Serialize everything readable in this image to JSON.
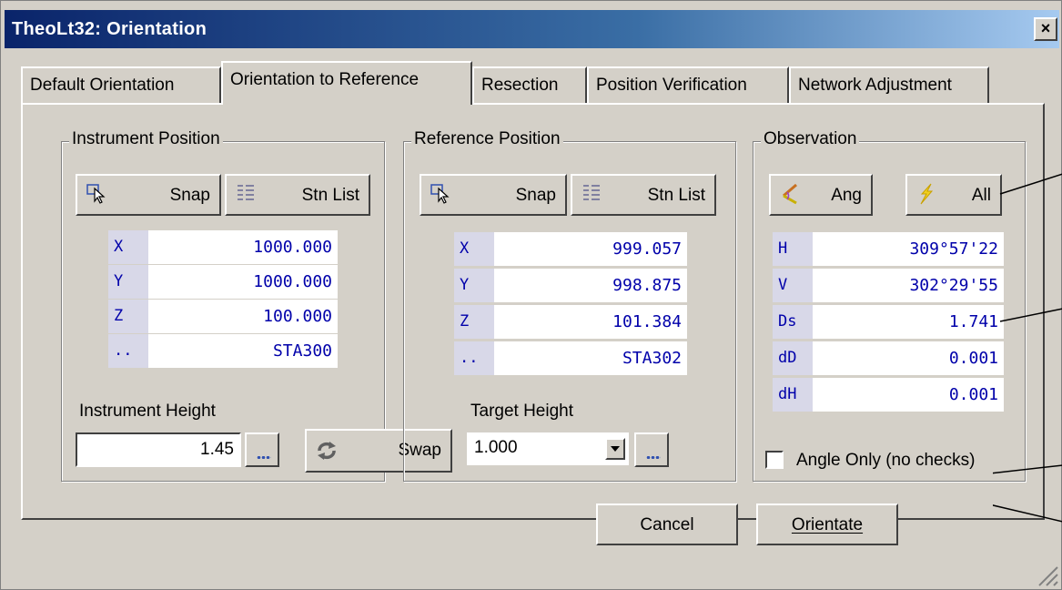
{
  "window": {
    "title": "TheoLt32: Orientation",
    "close_label": "×"
  },
  "tabs": [
    "Default Orientation",
    "Orientation to Reference",
    "Resection",
    "Position Verification",
    "Network Adjustment"
  ],
  "instrument": {
    "title": "Instrument Position",
    "snap": "Snap",
    "stnlist": "Stn List",
    "rows": [
      {
        "label": "X",
        "value": "1000.000"
      },
      {
        "label": "Y",
        "value": "1000.000"
      },
      {
        "label": "Z",
        "value": "100.000"
      },
      {
        "label": "..",
        "value": "STA300"
      }
    ],
    "height_label": "Instrument Height",
    "height_value": "1.45"
  },
  "reference": {
    "title": "Reference Position",
    "snap": "Snap",
    "stnlist": "Stn List",
    "rows": [
      {
        "label": "X",
        "value": "999.057"
      },
      {
        "label": "Y",
        "value": "998.875"
      },
      {
        "label": "Z",
        "value": "101.384"
      },
      {
        "label": "..",
        "value": "STA302"
      }
    ],
    "height_label": "Target Height",
    "height_value": "1.000"
  },
  "swap_label": "Swap",
  "observation": {
    "title": "Observation",
    "ang": "Ang",
    "all": "All",
    "rows": [
      {
        "label": "H",
        "value": "309°57'22"
      },
      {
        "label": "V",
        "value": "302°29'55"
      },
      {
        "label": "Ds",
        "value": "1.741"
      },
      {
        "label": "dD",
        "value": "0.001"
      },
      {
        "label": "dH",
        "value": "0.001"
      }
    ],
    "angle_only": "Angle Only (no checks)"
  },
  "footer": {
    "cancel": "Cancel",
    "orientate": "Orientate"
  },
  "colors": {
    "title_start": "#0a246a",
    "title_end": "#a6caf0",
    "face": "#d4d0c8",
    "field_text": "#0000aa"
  }
}
